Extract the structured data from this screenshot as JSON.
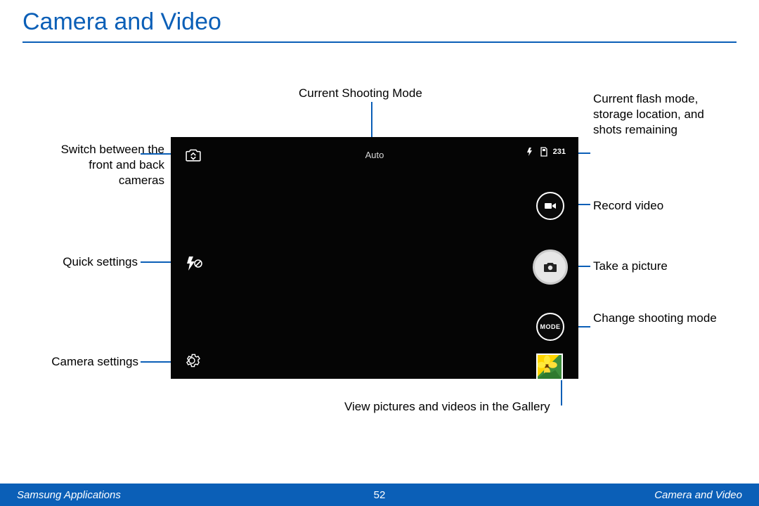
{
  "page": {
    "title": "Camera and Video",
    "number": "52",
    "footer_left": "Samsung Applications",
    "footer_right": "Camera and Video"
  },
  "callouts": {
    "shooting_mode": "Current Shooting Mode",
    "switch_cam": "Switch between the front and back cameras",
    "quick_settings": "Quick settings",
    "cam_settings": "Camera settings",
    "status": "Current flash mode, storage location, and shots remaining",
    "record": "Record video",
    "take_pic": "Take a picture",
    "change_mode": "Change shooting mode",
    "gallery": "View pictures and videos in the Gallery"
  },
  "viewfinder": {
    "mode_label": "Auto",
    "shots_remaining": "231",
    "mode_button_label": "MODE"
  }
}
